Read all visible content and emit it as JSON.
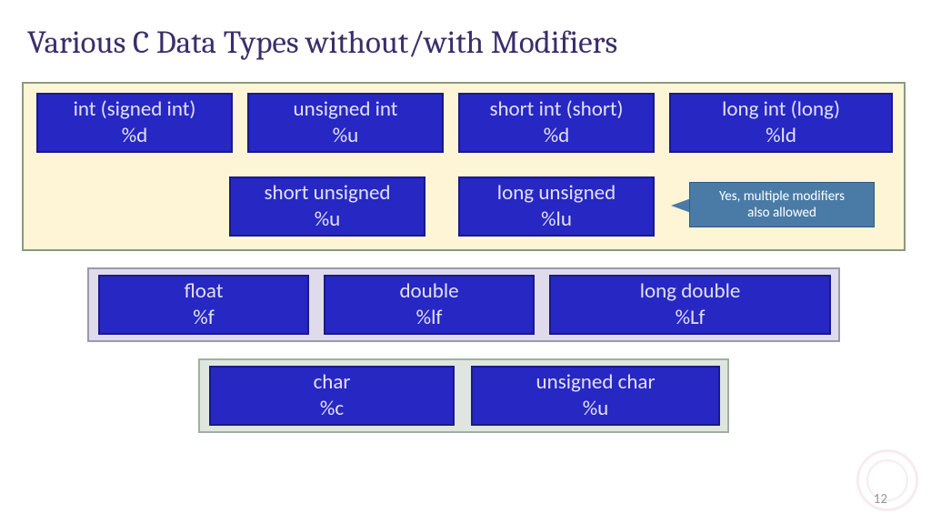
{
  "title": "Various C Data Types without/with Modifiers",
  "group1": {
    "row1": [
      {
        "name": "int (signed int)",
        "fmt": "%d"
      },
      {
        "name": "unsigned int",
        "fmt": "%u"
      },
      {
        "name": "short int (short)",
        "fmt": "%d"
      },
      {
        "name": "long int (long)",
        "fmt": "%ld"
      }
    ],
    "row2": [
      {
        "name": "short unsigned",
        "fmt": "%u"
      },
      {
        "name": "long unsigned",
        "fmt": "%lu"
      }
    ]
  },
  "callout": {
    "line1": "Yes, multiple modifiers",
    "line2": "also allowed"
  },
  "group2": [
    {
      "name": "float",
      "fmt": "%f"
    },
    {
      "name": "double",
      "fmt": "%lf"
    },
    {
      "name": "long double",
      "fmt": "%Lf"
    }
  ],
  "group3": [
    {
      "name": "char",
      "fmt": "%c"
    },
    {
      "name": "unsigned char",
      "fmt": "%u"
    }
  ],
  "page_number": "12"
}
